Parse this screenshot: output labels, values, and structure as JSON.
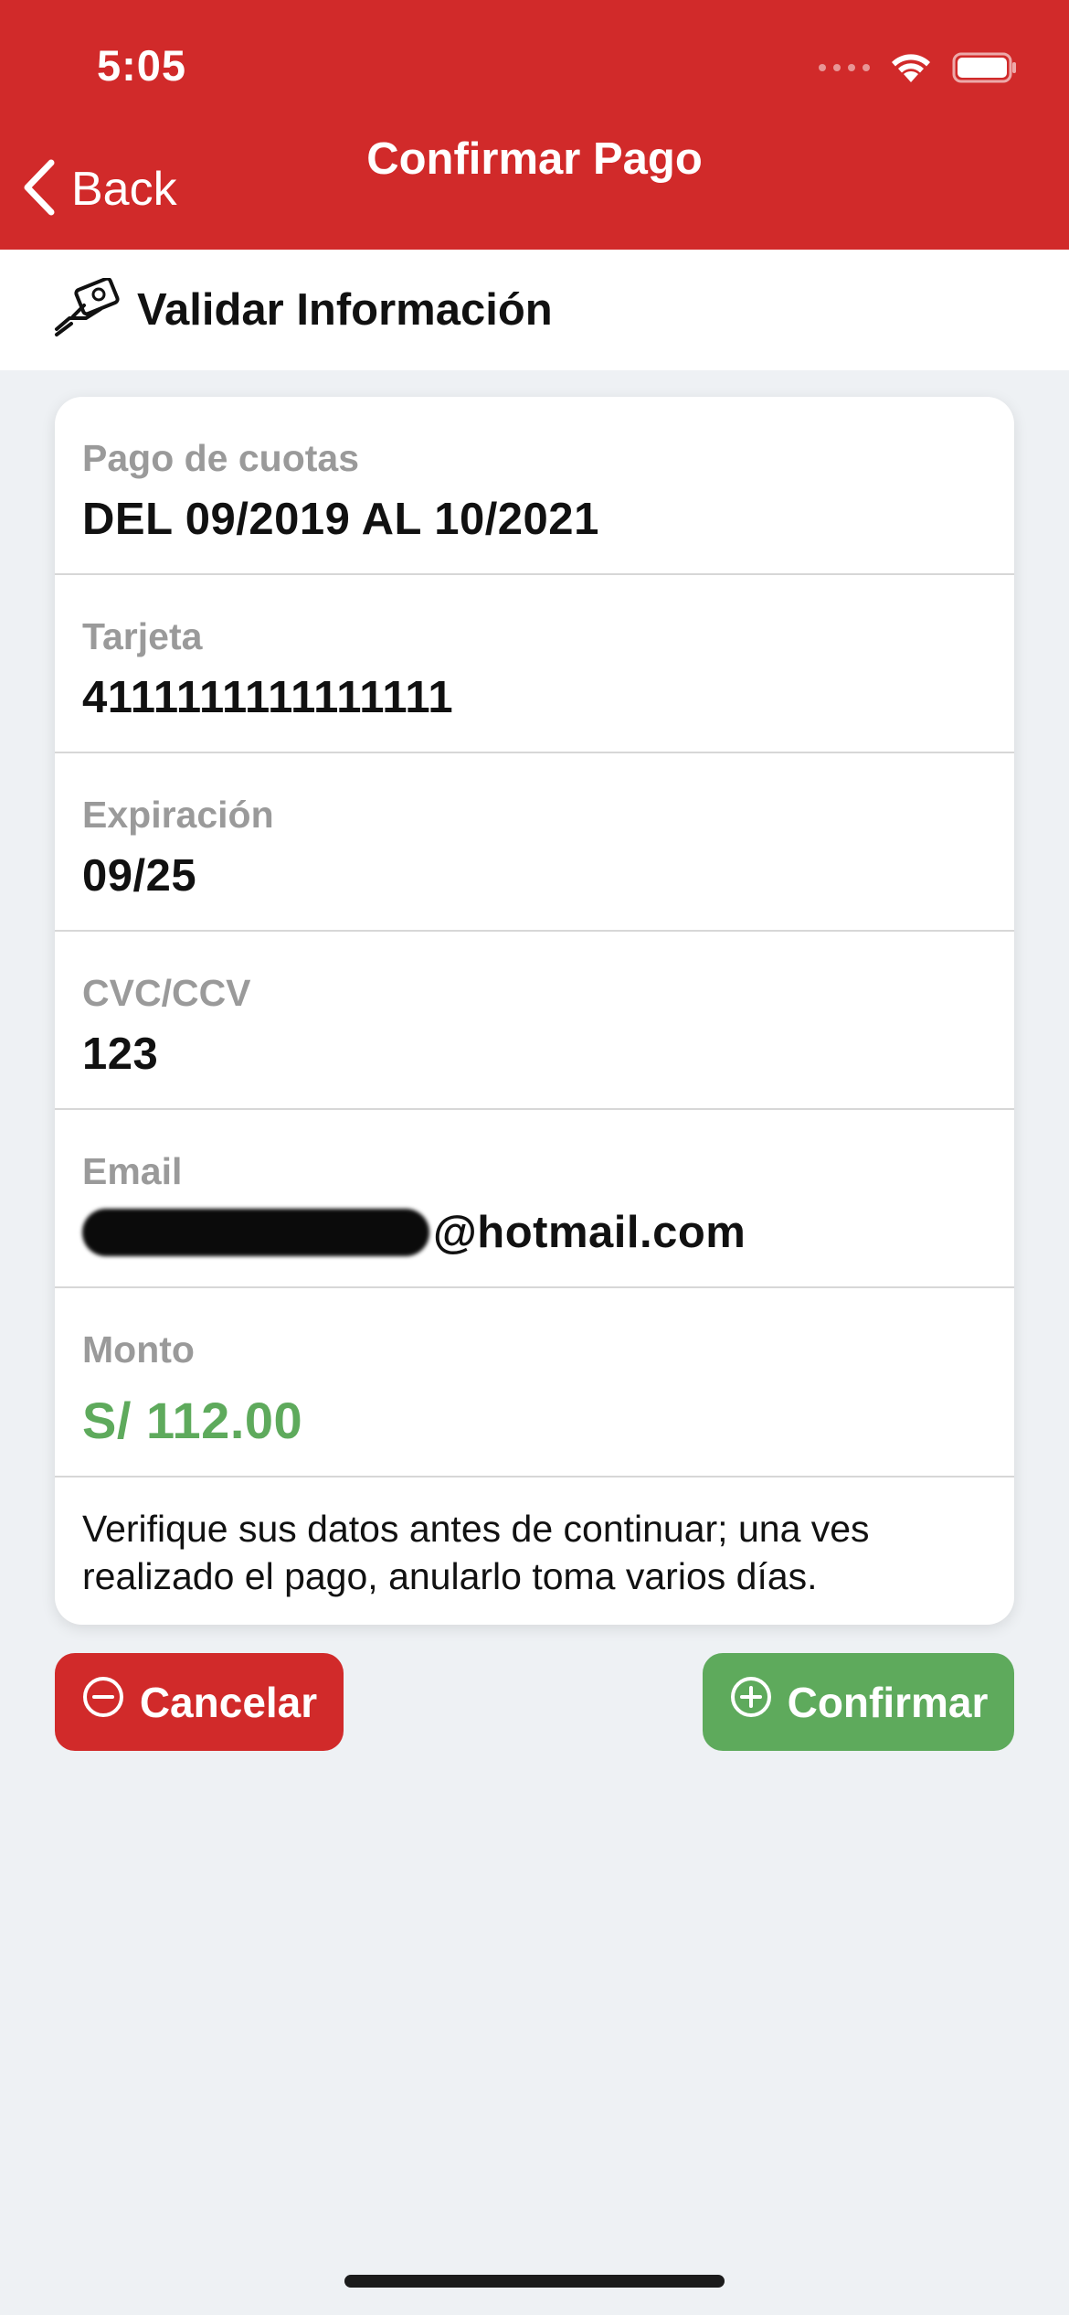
{
  "status_bar": {
    "time": "5:05"
  },
  "nav": {
    "back_label": "Back",
    "title": "Confirmar Pago"
  },
  "section": {
    "title": "Validar Información"
  },
  "rows": [
    {
      "label": "Pago de cuotas",
      "value": "DEL 09/2019 AL 10/2021"
    },
    {
      "label": "Tarjeta",
      "value": "4111111111111111"
    },
    {
      "label": "Expiración",
      "value": "09/25"
    },
    {
      "label": "CVC/CCV",
      "value": "123"
    },
    {
      "label": "Email",
      "value": "@hotmail.com"
    },
    {
      "label": "Monto",
      "value": "S/ 112.00"
    }
  ],
  "note": "Verifique sus datos antes de continuar; una ves realizado el pago, anularlo toma varios días.",
  "buttons": {
    "cancel_label": "Cancelar",
    "confirm_label": "Confirmar"
  },
  "colors": {
    "brand_red": "#d12a2a",
    "amount_green": "#5eaa5c",
    "background": "#eef1f4"
  },
  "icons": {
    "back": "chevron-left-icon",
    "section": "hand-card-icon",
    "cancel": "circle-minus-icon",
    "confirm": "circle-plus-icon",
    "wifi": "wifi-icon",
    "battery": "battery-icon"
  }
}
